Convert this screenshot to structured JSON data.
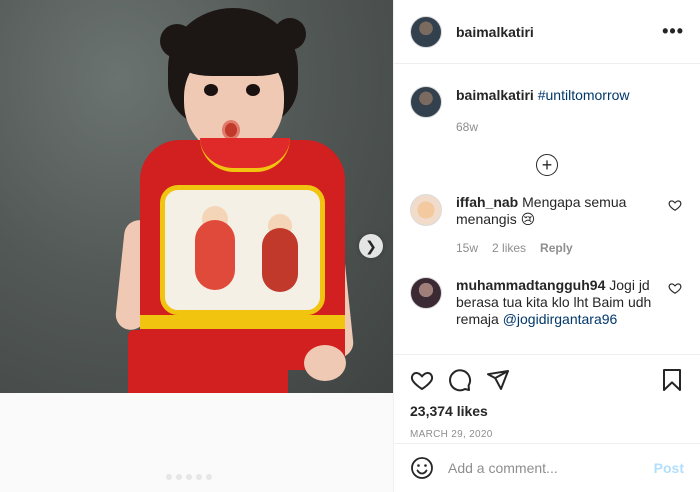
{
  "post": {
    "username": "baimalkatiri",
    "caption_user": "baimalkatiri",
    "caption_tag": "#untiltomorrow",
    "caption_age": "68w",
    "likes": "23,374 likes",
    "date": "MARCH 29, 2020"
  },
  "comments": [
    {
      "user": "iffah_nab",
      "text": " Mengapa semua menangis 😢",
      "age": "15w",
      "likes": "2 likes",
      "reply": "Reply"
    },
    {
      "user": "muhammadtangguh94",
      "text": " Jogi jd berasa tua kita klo lht Baim udh remaja ",
      "mention": "@jogidirgantara96"
    }
  ],
  "add_comment": {
    "placeholder": "Add a comment...",
    "post_label": "Post"
  },
  "icons": {
    "more": "more-options-icon",
    "load_more": "plus-circle-icon",
    "like": "heart-icon",
    "comment": "comment-icon",
    "share": "share-icon",
    "save": "bookmark-icon",
    "emoji": "emoji-icon",
    "next": "chevron-right-icon"
  },
  "colors": {
    "text": "#262626",
    "muted": "#8e8e8e",
    "link": "#00376b",
    "post_button": "#b2dffc",
    "border": "#efefef"
  }
}
